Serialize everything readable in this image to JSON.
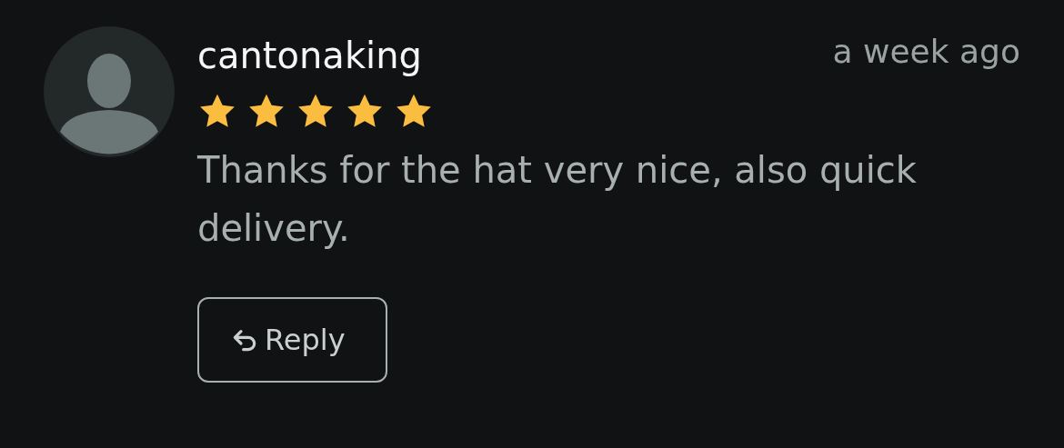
{
  "review": {
    "username": "cantonaking",
    "time": "a week ago",
    "stars": 5,
    "text": "Thanks for the hat very nice, also quick delivery.",
    "reply_button": "Reply"
  }
}
